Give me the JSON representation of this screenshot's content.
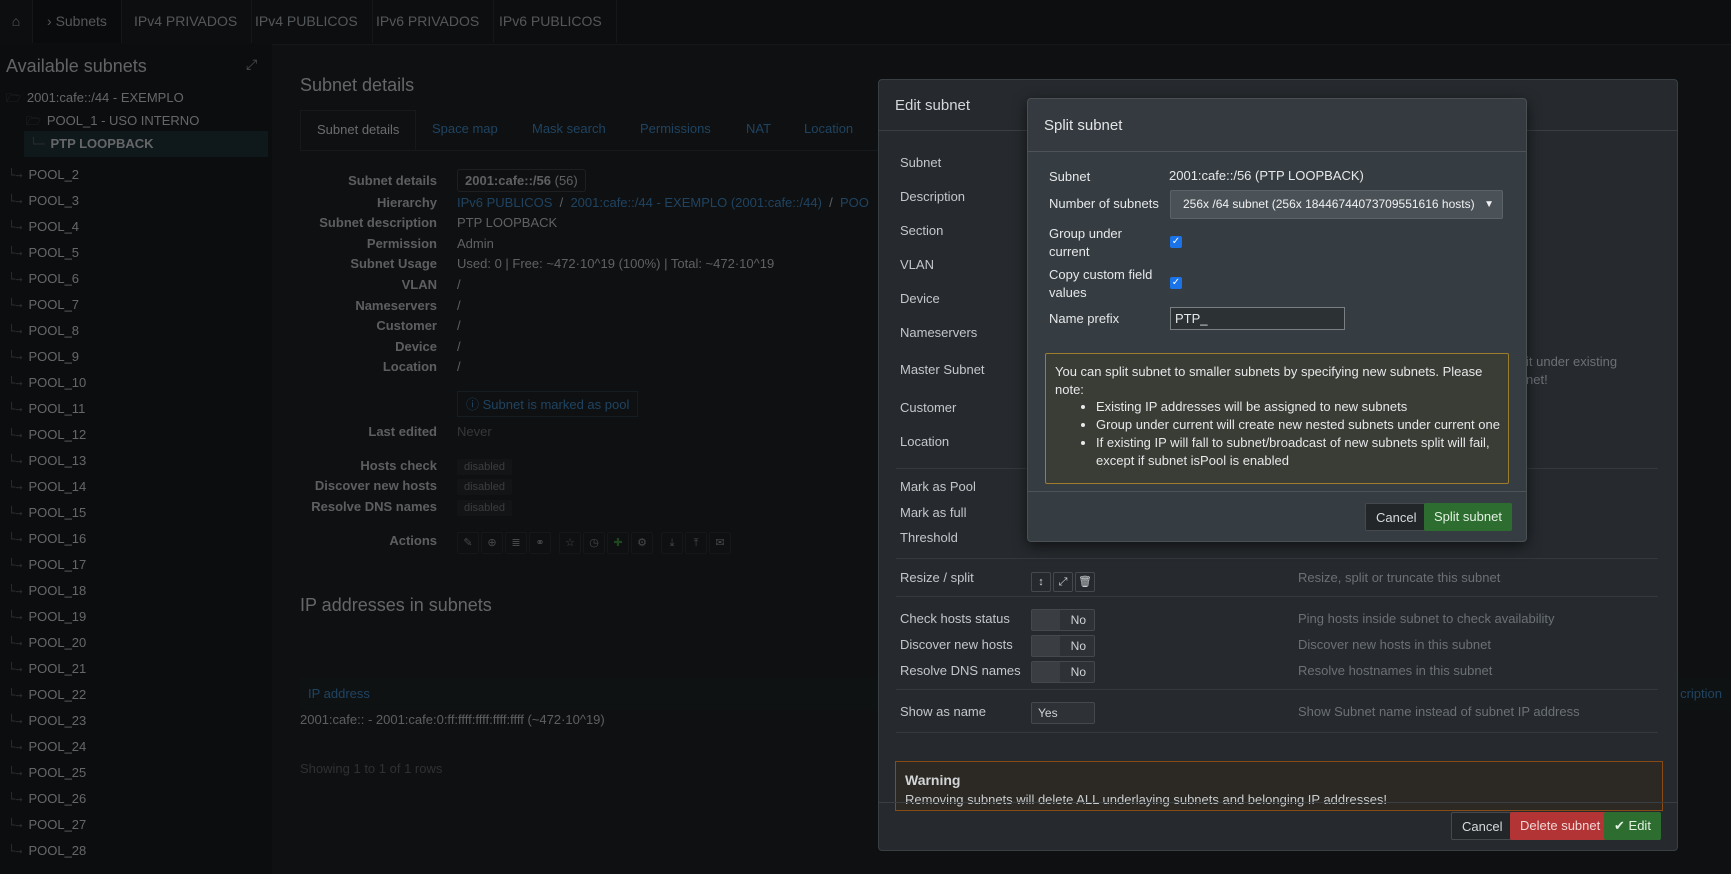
{
  "topnav": {
    "home_icon": "home-icon",
    "items": [
      "Subnets",
      "IPv4 PRIVADOS",
      "IPv4 PUBLICOS",
      "IPv6 PRIVADOS",
      "IPv6 PUBLICOS"
    ]
  },
  "sidebar": {
    "title": "Available subnets",
    "root": "2001:cafe::/44 - EXEMPLO",
    "pool1": "POOL_1 - USO INTERNO",
    "selected": "PTP LOOPBACK",
    "pools": [
      "POOL_2",
      "POOL_3",
      "POOL_4",
      "POOL_5",
      "POOL_6",
      "POOL_7",
      "POOL_8",
      "POOL_9",
      "POOL_10",
      "POOL_11",
      "POOL_12",
      "POOL_13",
      "POOL_14",
      "POOL_15",
      "POOL_16",
      "POOL_17",
      "POOL_18",
      "POOL_19",
      "POOL_20",
      "POOL_21",
      "POOL_22",
      "POOL_23",
      "POOL_24",
      "POOL_25",
      "POOL_26",
      "POOL_27",
      "POOL_28"
    ]
  },
  "main": {
    "title": "Subnet details",
    "tabs": [
      "Subnet details",
      "Space map",
      "Mask search",
      "Permissions",
      "NAT",
      "Location"
    ],
    "details": {
      "subnet_label": "Subnet details",
      "subnet_value": "2001:cafe::/56",
      "subnet_suffix": "(56)",
      "hierarchy_label": "Hierarchy",
      "hierarchy_1": "IPv6 PUBLICOS",
      "hierarchy_2": "2001:cafe::/44 - EXEMPLO (2001:cafe::/44)",
      "hierarchy_3": "POO",
      "description_label": "Subnet description",
      "description_value": "PTP LOOPBACK",
      "permission_label": "Permission",
      "permission_value": "Admin",
      "usage_label": "Subnet Usage",
      "usage_value": "Used: 0 | Free: ~472·10^19 (100%) | Total: ~472·10^19",
      "vlan_label": "VLAN",
      "nameservers_label": "Nameservers",
      "customer_label": "Customer",
      "device_label": "Device",
      "location_label": "Location",
      "slash": "/",
      "pool_info": "Subnet is marked as pool",
      "last_edited_label": "Last edited",
      "last_edited_value": "Never",
      "hosts_check_label": "Hosts check",
      "discover_label": "Discover new hosts",
      "resolve_label": "Resolve DNS names",
      "disabled": "disabled",
      "actions_label": "Actions"
    },
    "ip_title": "IP addresses in subnets",
    "ip_header": "IP address",
    "ip_header_right": "cription",
    "ip_row": "2001:cafe:: - 2001:cafe:0:ff:ffff:ffff:ffff:ffff (~472·10^19)",
    "showing": "Showing 1 to 1 of 1 rows"
  },
  "edit_modal": {
    "title": "Edit subnet",
    "labels": {
      "subnet": "Subnet",
      "description": "Description",
      "section": "Section",
      "vlan": "VLAN",
      "device": "Device",
      "nameservers": "Nameservers",
      "master": "Master Subnet",
      "customer": "Customer",
      "location": "Location",
      "mark_pool": "Mark as Pool",
      "mark_full": "Mark as full",
      "threshold": "Threshold",
      "resize": "Resize / split",
      "check_hosts": "Check hosts status",
      "discover": "Discover new hosts",
      "resolve": "Resolve DNS names",
      "show_name": "Show as name"
    },
    "help": {
      "master_1": "it under existing",
      "master_2": "net!",
      "resize": "Resize, split or truncate this subnet",
      "check_hosts": "Ping hosts inside subnet to check availability",
      "discover": "Discover new hosts in this subnet",
      "resolve": "Resolve hostnames in this subnet",
      "show_name": "Show Subnet name instead of subnet IP address"
    },
    "no": "No",
    "yes": "Yes",
    "warning_title": "Warning",
    "warning_body": "Removing subnets will delete ALL underlaying subnets and belonging IP addresses!",
    "cancel": "Cancel",
    "delete": "Delete subnet",
    "edit": "Edit"
  },
  "split_modal": {
    "title": "Split subnet",
    "subnet_label": "Subnet",
    "subnet_value": "2001:cafe::/56 (PTP LOOPBACK)",
    "number_label": "Number of subnets",
    "number_value": "256x /64 subnet (256x 18446744073709551616 hosts)",
    "group_label": "Group under current",
    "copy_label": "Copy custom field values",
    "prefix_label": "Name prefix",
    "prefix_value": "PTP_",
    "note_intro": "You can split subnet to smaller subnets by specifying new subnets. Please note:",
    "note_items": [
      "Existing IP addresses will be assigned to new subnets",
      "Group under current will create new nested subnets under current one",
      "If existing IP will fall to subnet/broadcast of new subnets split will fail, except if subnet isPool is enabled"
    ],
    "cancel": "Cancel",
    "submit": "Split subnet"
  },
  "colors": {
    "accent_link": "#3f86c2",
    "danger": "#b33434",
    "success": "#2d6d2f",
    "checkbox": "#1a73e8",
    "note_border": "#9b7d2d"
  }
}
